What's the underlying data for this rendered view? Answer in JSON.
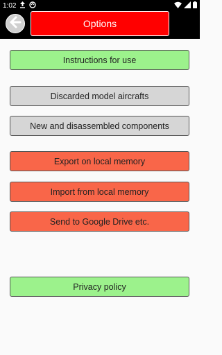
{
  "status_bar": {
    "time": "1:02",
    "icons": [
      "upload-icon",
      "sync-icon",
      "wifi-icon",
      "signal-icon",
      "battery-icon"
    ]
  },
  "header": {
    "title": "Options",
    "back_icon": "arrow-left-icon"
  },
  "buttons": [
    {
      "id": "instructions",
      "label": "Instructions for use",
      "color": "#9cf28c"
    },
    {
      "id": "discarded",
      "label": "Discarded model aircrafts",
      "color": "#d6d6d6"
    },
    {
      "id": "components",
      "label": "New and disassembled components",
      "color": "#d6d6d6"
    },
    {
      "id": "export",
      "label": "Export on local memory",
      "color": "#f96649"
    },
    {
      "id": "import",
      "label": "Import from local memory",
      "color": "#f96649"
    },
    {
      "id": "send",
      "label": "Send to Google Drive etc.",
      "color": "#f96649"
    },
    {
      "id": "privacy",
      "label": "Privacy policy",
      "color": "#9cf28c"
    }
  ]
}
